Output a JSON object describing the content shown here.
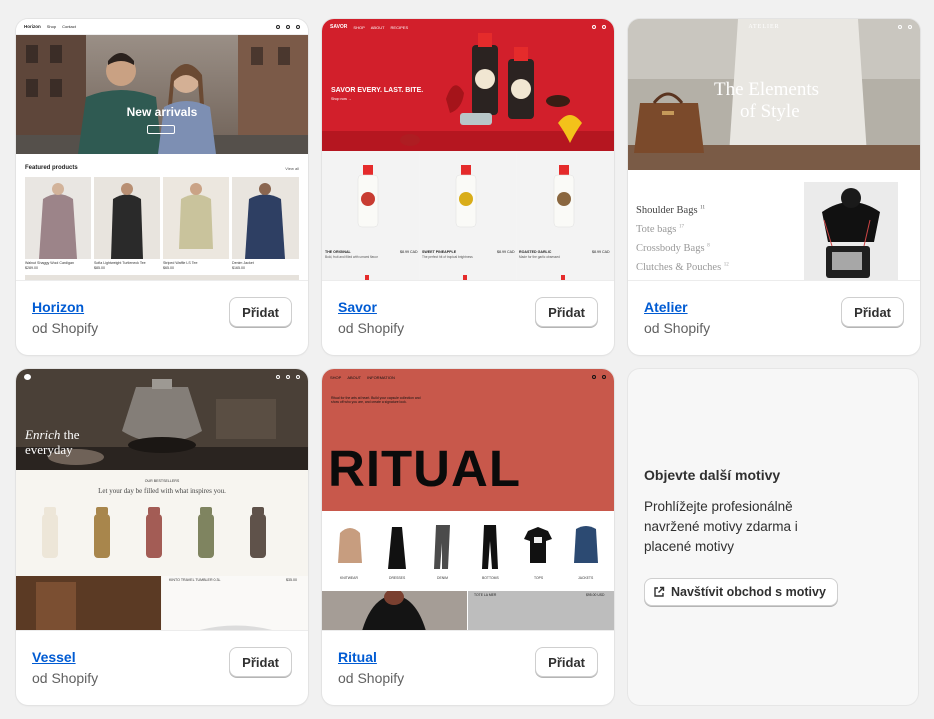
{
  "themes": [
    {
      "name": "Horizon",
      "author": "od Shopify",
      "add_label": "Přidat",
      "preview": {
        "brand": "Horizon",
        "nav": [
          "Shop",
          "Contact"
        ],
        "hero_title": "New arrivals",
        "section_title": "Featured products",
        "view_all": "View all",
        "products": [
          {
            "name": "Walnut Shaggy Wool Cardigan",
            "price": "$289.00"
          },
          {
            "name": "Sofia Lightweight Turtleneck Tee",
            "price": "$85.00"
          },
          {
            "name": "Striped Waffle LS Tee",
            "price": "$65.00"
          },
          {
            "name": "Denim Jacket",
            "price": "$165.00"
          }
        ]
      }
    },
    {
      "name": "Savor",
      "author": "od Shopify",
      "add_label": "Přidat",
      "preview": {
        "brand": "SAVOR",
        "nav": [
          "SHOP",
          "ABOUT",
          "RECIPES"
        ],
        "hero_title": "SAVOR EVERY. LAST. BITE.",
        "hero_link": "Shop now →",
        "bottle_label": "JAPANESE DIPPING SAUCE",
        "products": [
          {
            "name": "THE ORIGINAL",
            "price": "$8.99 CAD",
            "desc": "Bold, fruit and filled with umami flavor"
          },
          {
            "name": "SWEET PINEAPPLE",
            "price": "$8.99 CAD",
            "desc": "The perfect hit of tropical brightness"
          },
          {
            "name": "ROASTED GARLIC",
            "price": "$8.99 CAD",
            "desc": "Made for the garlic obsessed"
          }
        ]
      }
    },
    {
      "name": "Atelier",
      "author": "od Shopify",
      "add_label": "Přidat",
      "preview": {
        "brand": "ATELIER",
        "hero_title_1": "The Elements",
        "hero_title_2": "of Style",
        "categories": [
          {
            "label": "Shoulder Bags",
            "count": "11"
          },
          {
            "label": "Tote bags",
            "count": "17"
          },
          {
            "label": "Crossbody Bags",
            "count": "8"
          },
          {
            "label": "Clutches & Pouches",
            "count": "12"
          }
        ]
      }
    },
    {
      "name": "Vessel",
      "author": "od Shopify",
      "add_label": "Přidat",
      "preview": {
        "hero_italic": "Enrich",
        "hero_rest_1": "the",
        "hero_rest_2": "everyday",
        "section_kicker": "OUR BESTSELLERS",
        "section_title": "Let your day be filled with what inspires you.",
        "bottom_label": "KINTO TRAVEL TUMBLER 0.3L",
        "bottom_price": "$35.00",
        "bottle_colors": [
          "#ede6d8",
          "#a8864c",
          "#a35c55",
          "#7f8460",
          "#5f524a"
        ]
      }
    },
    {
      "name": "Ritual",
      "author": "od Shopify",
      "add_label": "Přidat",
      "preview": {
        "nav": [
          "SHOP",
          "ABOUT",
          "INFORMATION"
        ],
        "intro": "Ritual for the arts at heart. Build your capsule collection and show off who you are, and create a signature look.",
        "hero_title": "RITUAL",
        "categories": [
          "KNITWEAR",
          "DRESSES",
          "DENIM",
          "BOTTOMS",
          "TOPS",
          "JACKETS"
        ],
        "bottom_label": "TOTE LA MER",
        "bottom_price": "$95.00 USD"
      }
    }
  ],
  "explore": {
    "title": "Objevte další motivy",
    "description": "Prohlížejte profesionálně navržené motivy zdarma i placené motivy",
    "button_label": "Navštívit obchod s motivy"
  },
  "colors": {
    "link": "#005bd3",
    "savor_red": "#d21f2b",
    "ritual_red": "#c8584b"
  }
}
